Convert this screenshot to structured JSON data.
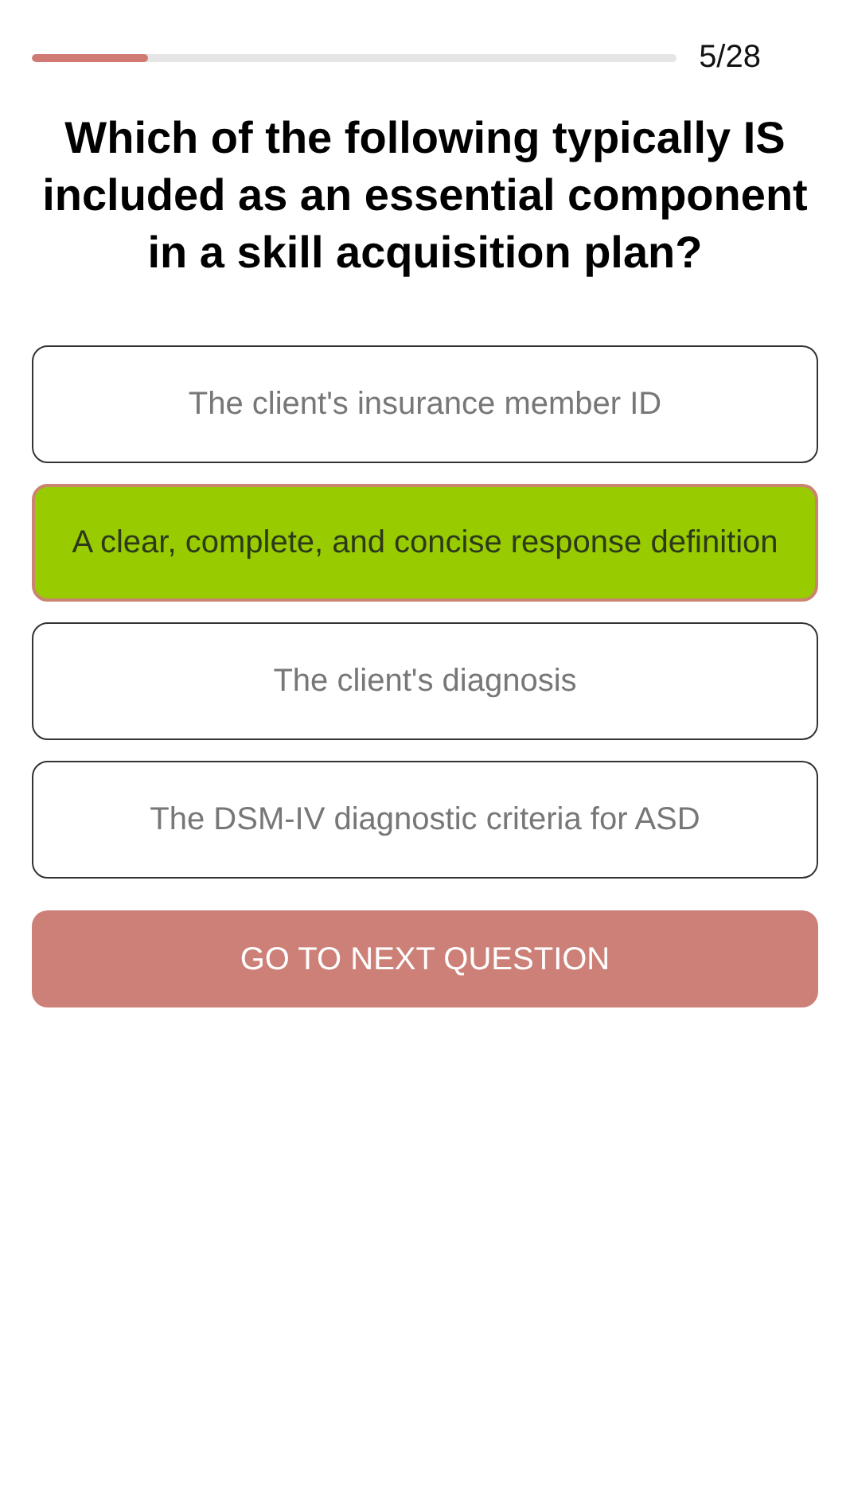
{
  "progress": {
    "level": 0.18,
    "counter": "5/28"
  },
  "question": "Which of the following typically IS included as an essential component in a skill acquisition plan?",
  "options": [
    {
      "label": "The client's insurance member ID",
      "selected": false
    },
    {
      "label": "A clear, complete, and concise response definition",
      "selected": true
    },
    {
      "label": "The client's diagnosis",
      "selected": false
    },
    {
      "label": "The DSM-IV diagnostic criteria for ASD",
      "selected": false
    }
  ],
  "next_button": "GO TO NEXT QUESTION"
}
